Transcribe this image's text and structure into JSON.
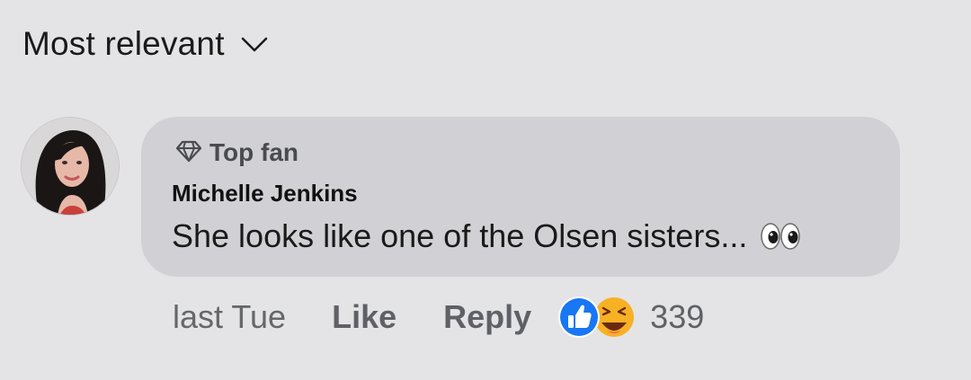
{
  "sort": {
    "label": "Most relevant",
    "icon": "chevron-down-icon"
  },
  "comment": {
    "badge": {
      "icon": "diamond-icon",
      "label": "Top fan"
    },
    "author": "Michelle Jenkins",
    "text": "She looks like one of the Olsen sisters...",
    "emoji": "eyes-emoji",
    "time": "last Tue",
    "like_label": "Like",
    "reply_label": "Reply",
    "reactions": {
      "icons": [
        "like-reaction-icon",
        "haha-reaction-icon"
      ],
      "count": "339",
      "colors": {
        "like": "#1877f2",
        "haha": "#f7b125"
      }
    }
  },
  "colors": {
    "background": "#e4e4e6",
    "bubble": "#d1d1d5",
    "muted_text": "#65676b"
  }
}
